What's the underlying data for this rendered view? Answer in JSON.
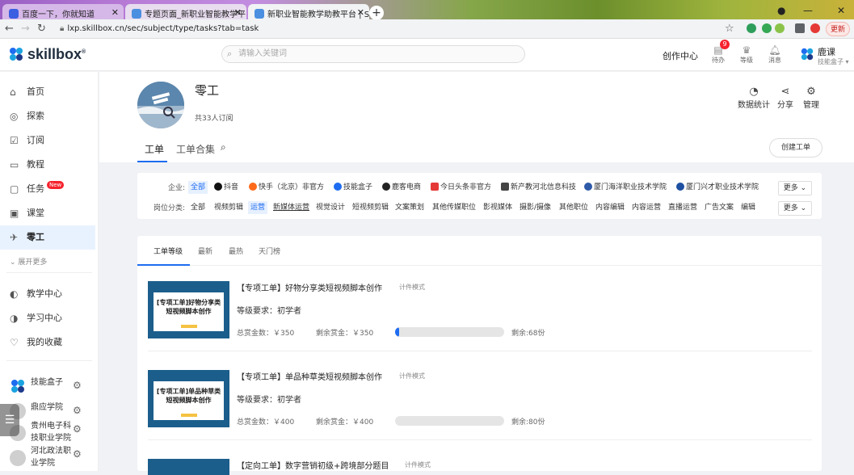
{
  "browser": {
    "tabs": [
      {
        "title": "百度一下，你就知道"
      },
      {
        "title": "专题页面_新职业智能教学平台"
      },
      {
        "title": "新职业智能教学助教平台 | Sk"
      }
    ],
    "url": "lxp.skillbox.cn/sec/subject/type/tasks?tab=task",
    "update_label": "更新"
  },
  "header": {
    "brand": "skillbox",
    "search_placeholder": "请输入关键词",
    "create_center": "创作中心",
    "icons": [
      {
        "label": "待办",
        "icon": "todo-icon",
        "badge": "9"
      },
      {
        "label": "等级",
        "icon": "crown-icon"
      },
      {
        "label": "消息",
        "icon": "bell-icon"
      }
    ],
    "user": {
      "name": "鹿课",
      "org": "技能盒子"
    }
  },
  "sidebar": {
    "items": [
      {
        "label": "首页",
        "icon": "home-icon"
      },
      {
        "label": "探索",
        "icon": "compass-icon"
      },
      {
        "label": "订阅",
        "icon": "subscribe-icon"
      },
      {
        "label": "教程",
        "icon": "book-icon"
      },
      {
        "label": "任务",
        "icon": "task-icon",
        "badge": "New"
      },
      {
        "label": "课堂",
        "icon": "classroom-icon"
      },
      {
        "label": "零工",
        "icon": "gig-icon",
        "active": true
      }
    ],
    "expand_label": "展开更多",
    "items2": [
      {
        "label": "教学中心",
        "icon": "teaching-icon"
      },
      {
        "label": "学习中心",
        "icon": "learning-icon"
      },
      {
        "label": "我的收藏",
        "icon": "heart-icon"
      }
    ],
    "orgs": [
      {
        "name": "技能盒子"
      },
      {
        "name": "鼎应学院"
      },
      {
        "name": "贵州电子科技职业学院"
      },
      {
        "name": "河北政法职业学院"
      }
    ]
  },
  "profile": {
    "title": "零工",
    "subscribers": "共33人订阅",
    "actions": [
      {
        "label": "数据统计",
        "icon": "stats-icon"
      },
      {
        "label": "分享",
        "icon": "share-icon"
      },
      {
        "label": "管理",
        "icon": "gear-icon"
      }
    ],
    "tabs": [
      "工单",
      "工单合集"
    ],
    "create_button": "创建工单"
  },
  "filter": {
    "company_label": "企业:",
    "companies": [
      "全部",
      "抖音",
      "快手（北京）非官方",
      "技能盒子",
      "鹿客电商",
      "今日头条非官方",
      "新产教河北信息科技",
      "厦门海洋职业技术学院",
      "厦门兴才职业技术学院"
    ],
    "category_label": "岗位分类:",
    "categories": [
      "全部",
      "视频剪辑",
      "运营",
      "新媒体运营",
      "视觉设计",
      "短视频剪辑",
      "文案策划",
      "其他传媒职位",
      "影视媒体",
      "摄影/摄像",
      "其他职位",
      "内容编辑",
      "内容运营",
      "直播运营",
      "广告文案",
      "编辑"
    ],
    "more_label": "更多"
  },
  "list": {
    "sort_tabs": [
      "工单等级",
      "最新",
      "最热",
      "天门榜"
    ],
    "cards": [
      {
        "title": "【专项工单】好物分享类短视频脚本创作",
        "mode": "计件模式",
        "thumb_text": "[专项工单]好物分享类短视频脚本创作",
        "level": "等级要求：初学者",
        "total": "总赏金数：￥350",
        "remaining_money": "剩余赏金：￥350",
        "progress": 0.04,
        "remaining_count": "剩余:68份"
      },
      {
        "title": "【专项工单】单品种草类短视频脚本创作",
        "mode": "计件模式",
        "thumb_text": "[专项工单]单品种草类短视频脚本创作",
        "level": "等级要求：初学者",
        "total": "总赏金数：￥400",
        "remaining_money": "剩余赏金：￥400",
        "progress": 0,
        "remaining_count": "剩余:80份"
      },
      {
        "title": "【定向工单】数字营销初级+跨境部分题目",
        "mode": "计件模式"
      }
    ]
  },
  "colors": {
    "accent": "#1e6cf0",
    "badge": "#f5222d",
    "thumb": "#1b5e8c"
  }
}
